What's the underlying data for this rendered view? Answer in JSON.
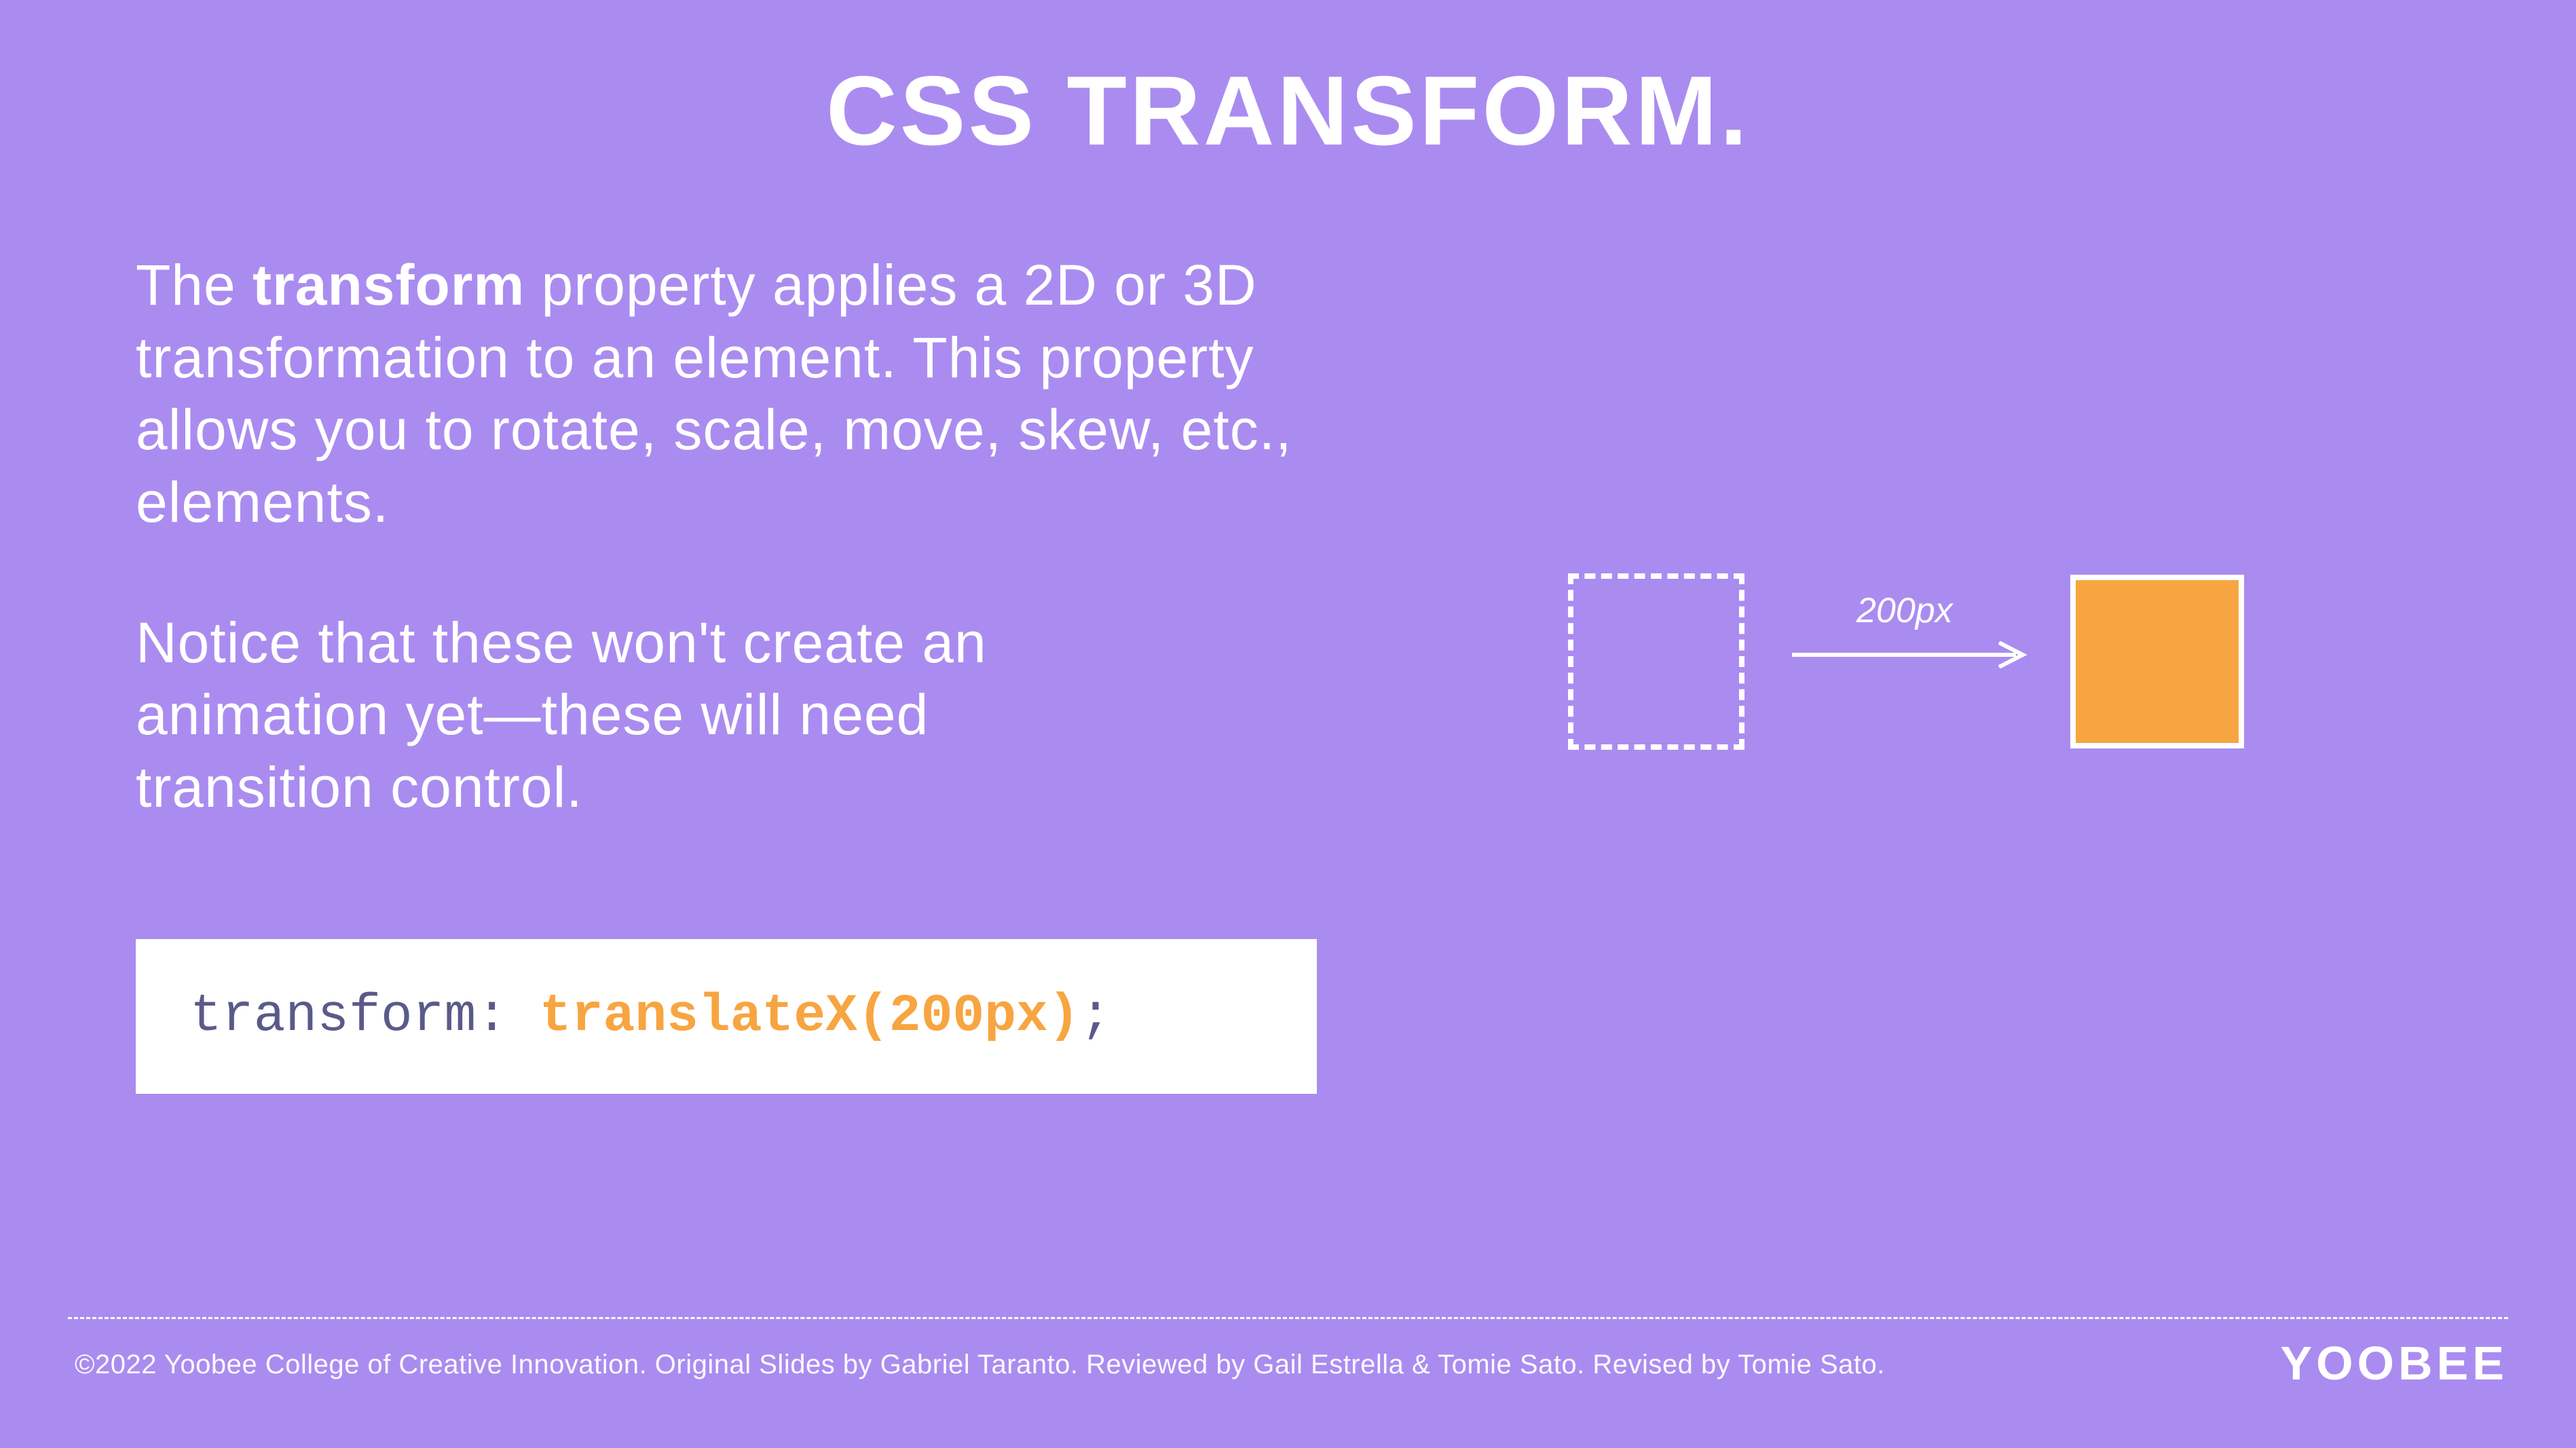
{
  "title": "CSS TRANSFORM.",
  "paragraph1": {
    "pre": "The ",
    "bold": "transform",
    "post": " property applies a 2D or 3D transformation to an element. This property allows you to rotate, scale, move, skew, etc., elements."
  },
  "paragraph2": "Notice that these won't create an animation yet—these will need transition control.",
  "code": {
    "property": "transform: ",
    "value": "translateX(200px)",
    "semicolon": ";"
  },
  "diagram": {
    "arrow_label": "200px"
  },
  "footer": "©2022 Yoobee College of Creative Innovation.  Original Slides by Gabriel Taranto.  Reviewed by Gail Estrella & Tomie Sato.  Revised by Tomie Sato.",
  "logo": "YOOBEE"
}
